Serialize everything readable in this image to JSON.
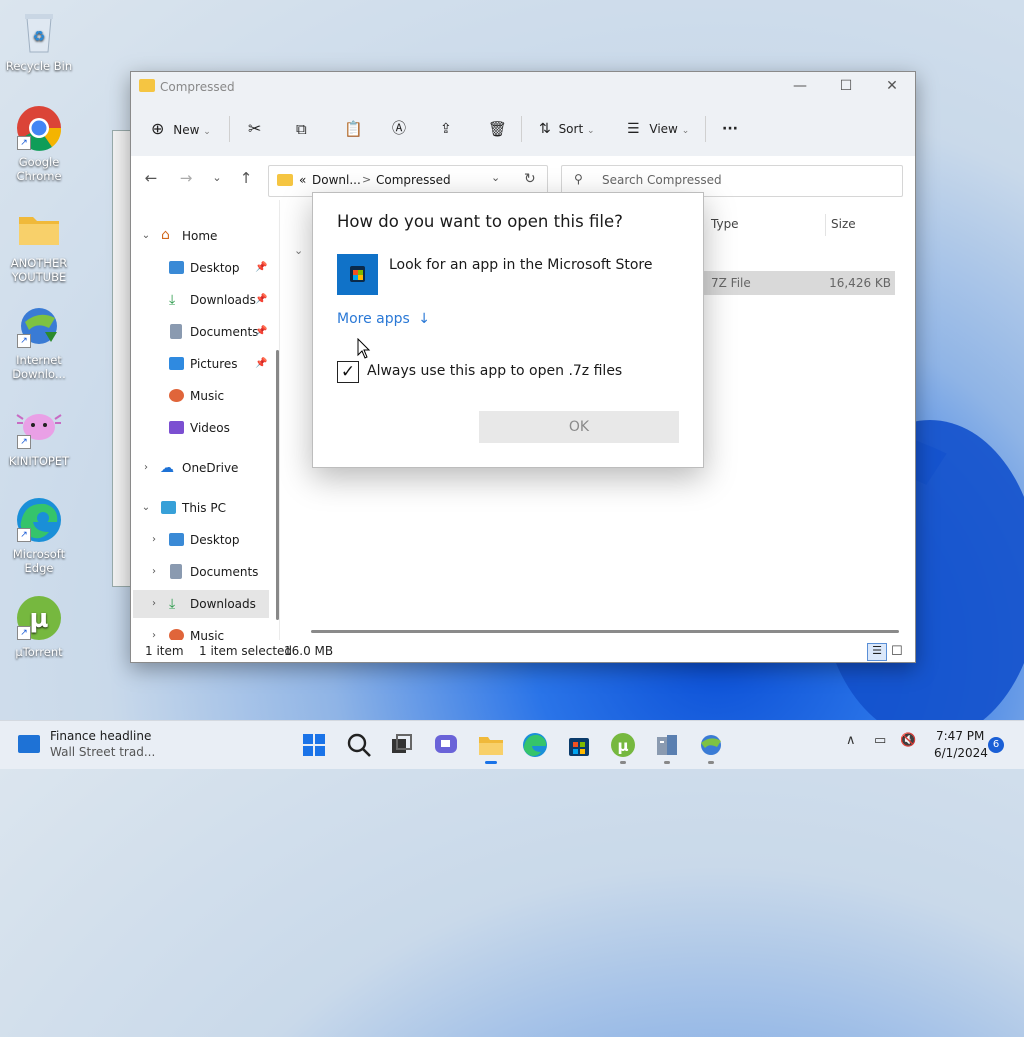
{
  "desktop": {
    "icons": [
      {
        "label": "Recycle Bin"
      },
      {
        "label": "Google Chrome"
      },
      {
        "label": "ANOTHER YOUTUBE"
      },
      {
        "label": "Internet Downlo..."
      },
      {
        "label": "KINITOPET"
      },
      {
        "label": "Microsoft Edge"
      },
      {
        "label": "µTorrent"
      }
    ]
  },
  "window": {
    "title": "Compressed",
    "toolbar": {
      "new_label": "New",
      "sort_label": "Sort",
      "view_label": "View",
      "more_label": "···"
    },
    "address": {
      "prefix": "«",
      "crumb1": "Downl...",
      "crumb2": "Compressed",
      "separator": ">"
    },
    "search_placeholder": "Search Compressed",
    "nav": {
      "home": "Home",
      "desktop": "Desktop",
      "downloads": "Downloads",
      "documents": "Documents",
      "pictures": "Pictures",
      "music": "Music",
      "videos": "Videos",
      "onedrive": "OneDrive",
      "thispc": "This PC",
      "pc_desktop": "Desktop",
      "pc_documents": "Documents",
      "pc_downloads": "Downloads",
      "pc_music": "Music"
    },
    "columns": {
      "type": "Type",
      "size": "Size"
    },
    "file": {
      "type": "7Z File",
      "size": "16,426 KB"
    },
    "status": {
      "count": "1 item",
      "selected": "1 item selected",
      "size": "16.0 MB"
    }
  },
  "dialog": {
    "title": "How do you want to open this file?",
    "store_option": "Look for an app in the Microsoft Store",
    "more_apps": "More apps",
    "more_apps_arrow": "↓",
    "checkbox_label": "Always use this app to open .7z files",
    "checkbox_checked": true,
    "ok_label": "OK"
  },
  "taskbar": {
    "news_title": "Finance headline",
    "news_sub": "Wall Street trad...",
    "time": "7:47 PM",
    "date": "6/1/2024",
    "notification_count": "6"
  },
  "colors": {
    "accent": "#2b79d6",
    "store_blue": "#1072c8",
    "folder_yellow": "#f5c542"
  }
}
